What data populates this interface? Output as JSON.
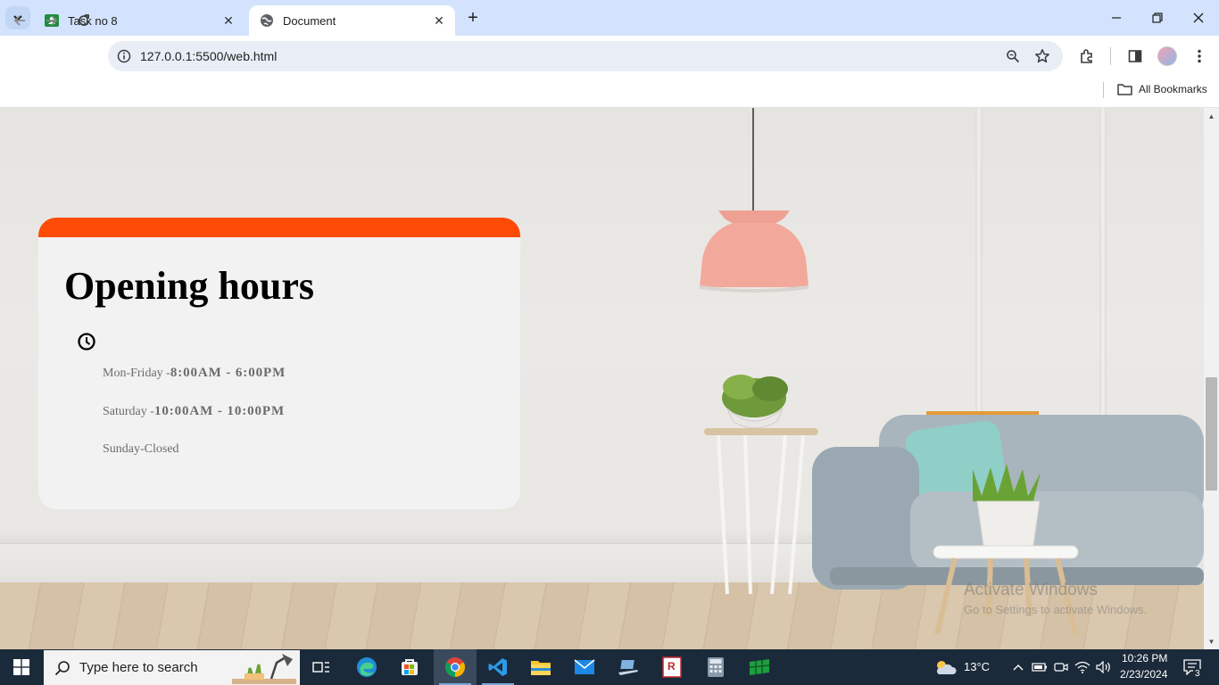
{
  "browser": {
    "tabs": [
      {
        "title": "Task no 8",
        "favicon": "google-classroom-icon",
        "active": false
      },
      {
        "title": "Document",
        "favicon": "globe-icon",
        "active": true
      }
    ],
    "url": "127.0.0.1:5500/web.html",
    "bookmarks": {
      "all_label": "All Bookmarks"
    }
  },
  "page": {
    "card": {
      "title": "Opening hours",
      "accent_color": "#fe4b05",
      "lines": [
        {
          "day": "Mon-Friday -",
          "hours": "8:00AM - 6:00PM"
        },
        {
          "day": "Saturday -",
          "hours": "10:00AM - 10:00PM"
        },
        {
          "day": "Sunday-Closed",
          "hours": ""
        }
      ]
    },
    "watermark": {
      "line1": "Activate Windows",
      "line2": "Go to Settings to activate Windows."
    }
  },
  "taskbar": {
    "search_placeholder": "Type here to search",
    "weather": "13°C",
    "time": "10:26 PM",
    "date": "2/23/2024",
    "notifications": "3",
    "apps": [
      "task-view-icon",
      "edge-icon",
      "store-icon",
      "chrome-icon",
      "vscode-icon",
      "file-explorer-icon",
      "mail-icon",
      "laptop-icon",
      "resume-app-icon",
      "calculator-icon",
      "spreadsheet-app-icon"
    ]
  }
}
